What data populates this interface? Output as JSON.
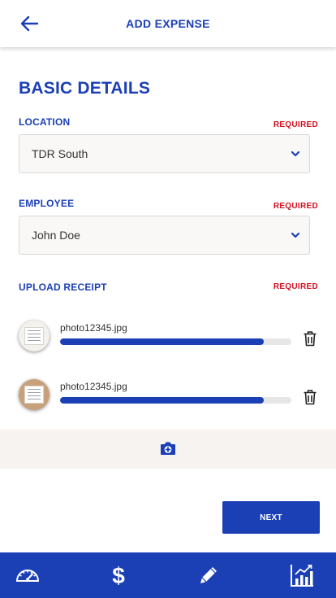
{
  "header": {
    "title": "ADD EXPENSE",
    "back_icon": "arrow-left-icon"
  },
  "section": {
    "title": "BASIC DETAILS"
  },
  "fields": {
    "location": {
      "label": "LOCATION",
      "required": "REQUIRED",
      "value": "TDR South"
    },
    "employee": {
      "label": "EMPLOYEE",
      "required": "REQUIRED",
      "value": "John Doe"
    },
    "receipt": {
      "label": "UPLOAD RECEIPT",
      "required": "REQUIRED"
    }
  },
  "uploads": [
    {
      "filename": "photo12345.jpg",
      "progress_percent": 88
    },
    {
      "filename": "photo12345.jpg",
      "progress_percent": 88
    }
  ],
  "add_photo_icon": "camera-plus-icon",
  "next_label": "NEXT",
  "bottom_nav": [
    "dashboard-gauge-icon",
    "dollar-icon",
    "pencil-icon",
    "chart-icon"
  ],
  "colors": {
    "primary": "#1b3fb5",
    "required": "#d10f1f",
    "add_photo_bg": "#f6f3f1"
  }
}
